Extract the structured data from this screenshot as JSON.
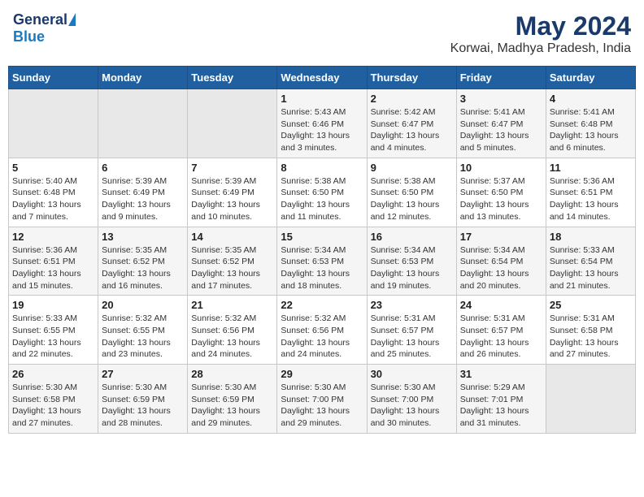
{
  "logo": {
    "general": "General",
    "blue": "Blue"
  },
  "title": "May 2024",
  "subtitle": "Korwai, Madhya Pradesh, India",
  "days_of_week": [
    "Sunday",
    "Monday",
    "Tuesday",
    "Wednesday",
    "Thursday",
    "Friday",
    "Saturday"
  ],
  "weeks": [
    [
      {
        "day": "",
        "info": ""
      },
      {
        "day": "",
        "info": ""
      },
      {
        "day": "",
        "info": ""
      },
      {
        "day": "1",
        "info": "Sunrise: 5:43 AM\nSunset: 6:46 PM\nDaylight: 13 hours and 3 minutes."
      },
      {
        "day": "2",
        "info": "Sunrise: 5:42 AM\nSunset: 6:47 PM\nDaylight: 13 hours and 4 minutes."
      },
      {
        "day": "3",
        "info": "Sunrise: 5:41 AM\nSunset: 6:47 PM\nDaylight: 13 hours and 5 minutes."
      },
      {
        "day": "4",
        "info": "Sunrise: 5:41 AM\nSunset: 6:48 PM\nDaylight: 13 hours and 6 minutes."
      }
    ],
    [
      {
        "day": "5",
        "info": "Sunrise: 5:40 AM\nSunset: 6:48 PM\nDaylight: 13 hours and 7 minutes."
      },
      {
        "day": "6",
        "info": "Sunrise: 5:39 AM\nSunset: 6:49 PM\nDaylight: 13 hours and 9 minutes."
      },
      {
        "day": "7",
        "info": "Sunrise: 5:39 AM\nSunset: 6:49 PM\nDaylight: 13 hours and 10 minutes."
      },
      {
        "day": "8",
        "info": "Sunrise: 5:38 AM\nSunset: 6:50 PM\nDaylight: 13 hours and 11 minutes."
      },
      {
        "day": "9",
        "info": "Sunrise: 5:38 AM\nSunset: 6:50 PM\nDaylight: 13 hours and 12 minutes."
      },
      {
        "day": "10",
        "info": "Sunrise: 5:37 AM\nSunset: 6:50 PM\nDaylight: 13 hours and 13 minutes."
      },
      {
        "day": "11",
        "info": "Sunrise: 5:36 AM\nSunset: 6:51 PM\nDaylight: 13 hours and 14 minutes."
      }
    ],
    [
      {
        "day": "12",
        "info": "Sunrise: 5:36 AM\nSunset: 6:51 PM\nDaylight: 13 hours and 15 minutes."
      },
      {
        "day": "13",
        "info": "Sunrise: 5:35 AM\nSunset: 6:52 PM\nDaylight: 13 hours and 16 minutes."
      },
      {
        "day": "14",
        "info": "Sunrise: 5:35 AM\nSunset: 6:52 PM\nDaylight: 13 hours and 17 minutes."
      },
      {
        "day": "15",
        "info": "Sunrise: 5:34 AM\nSunset: 6:53 PM\nDaylight: 13 hours and 18 minutes."
      },
      {
        "day": "16",
        "info": "Sunrise: 5:34 AM\nSunset: 6:53 PM\nDaylight: 13 hours and 19 minutes."
      },
      {
        "day": "17",
        "info": "Sunrise: 5:34 AM\nSunset: 6:54 PM\nDaylight: 13 hours and 20 minutes."
      },
      {
        "day": "18",
        "info": "Sunrise: 5:33 AM\nSunset: 6:54 PM\nDaylight: 13 hours and 21 minutes."
      }
    ],
    [
      {
        "day": "19",
        "info": "Sunrise: 5:33 AM\nSunset: 6:55 PM\nDaylight: 13 hours and 22 minutes."
      },
      {
        "day": "20",
        "info": "Sunrise: 5:32 AM\nSunset: 6:55 PM\nDaylight: 13 hours and 23 minutes."
      },
      {
        "day": "21",
        "info": "Sunrise: 5:32 AM\nSunset: 6:56 PM\nDaylight: 13 hours and 24 minutes."
      },
      {
        "day": "22",
        "info": "Sunrise: 5:32 AM\nSunset: 6:56 PM\nDaylight: 13 hours and 24 minutes."
      },
      {
        "day": "23",
        "info": "Sunrise: 5:31 AM\nSunset: 6:57 PM\nDaylight: 13 hours and 25 minutes."
      },
      {
        "day": "24",
        "info": "Sunrise: 5:31 AM\nSunset: 6:57 PM\nDaylight: 13 hours and 26 minutes."
      },
      {
        "day": "25",
        "info": "Sunrise: 5:31 AM\nSunset: 6:58 PM\nDaylight: 13 hours and 27 minutes."
      }
    ],
    [
      {
        "day": "26",
        "info": "Sunrise: 5:30 AM\nSunset: 6:58 PM\nDaylight: 13 hours and 27 minutes."
      },
      {
        "day": "27",
        "info": "Sunrise: 5:30 AM\nSunset: 6:59 PM\nDaylight: 13 hours and 28 minutes."
      },
      {
        "day": "28",
        "info": "Sunrise: 5:30 AM\nSunset: 6:59 PM\nDaylight: 13 hours and 29 minutes."
      },
      {
        "day": "29",
        "info": "Sunrise: 5:30 AM\nSunset: 7:00 PM\nDaylight: 13 hours and 29 minutes."
      },
      {
        "day": "30",
        "info": "Sunrise: 5:30 AM\nSunset: 7:00 PM\nDaylight: 13 hours and 30 minutes."
      },
      {
        "day": "31",
        "info": "Sunrise: 5:29 AM\nSunset: 7:01 PM\nDaylight: 13 hours and 31 minutes."
      },
      {
        "day": "",
        "info": ""
      }
    ]
  ]
}
